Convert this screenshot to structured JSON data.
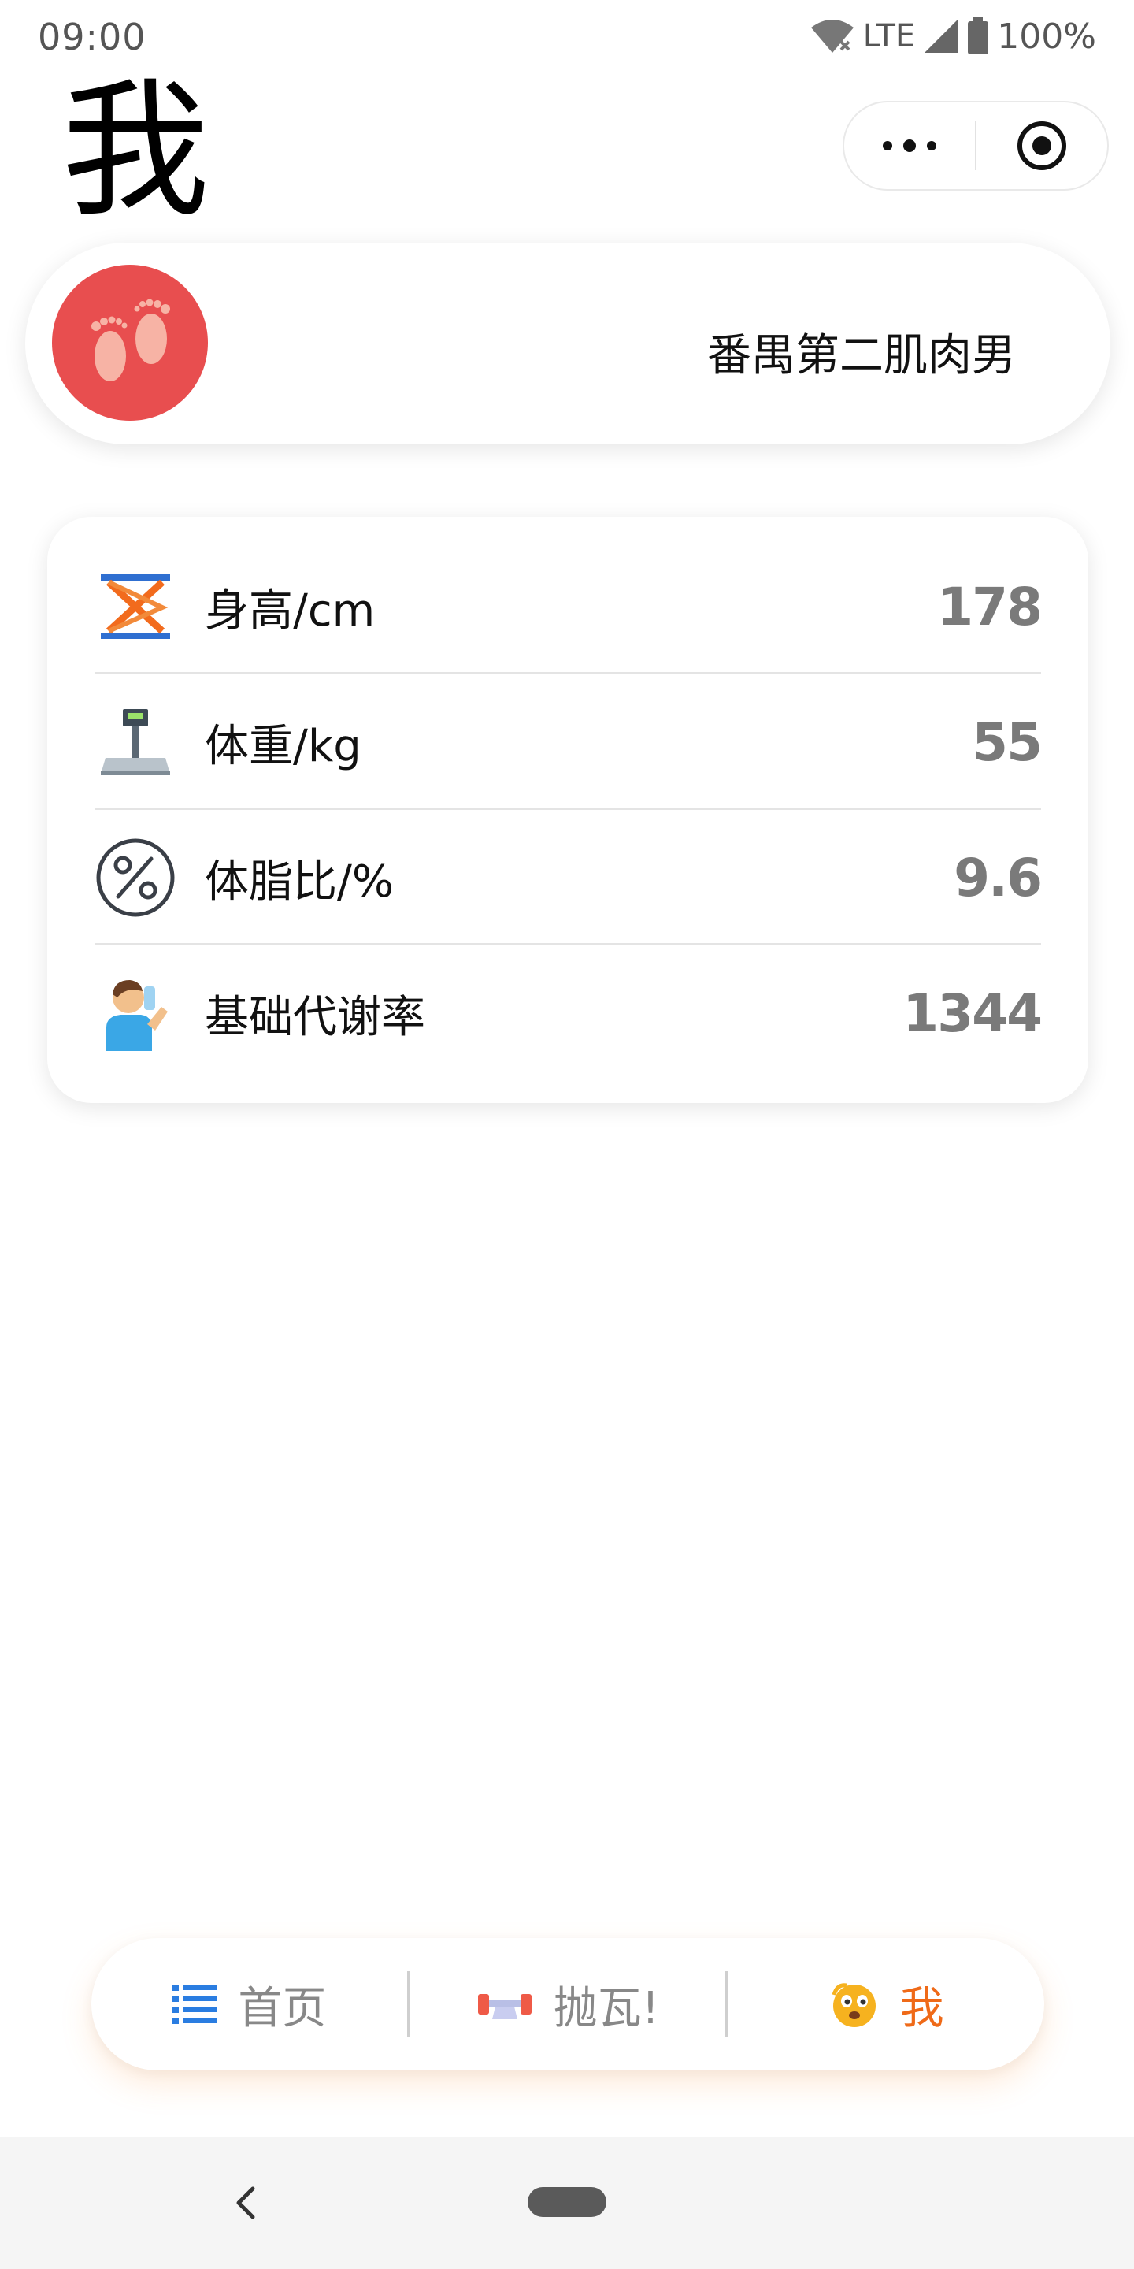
{
  "status_bar": {
    "time": "09:00",
    "network": "LTE",
    "battery": "100%"
  },
  "header": {
    "title": "我"
  },
  "profile": {
    "nickname": "番禺第二肌肉男",
    "avatar_icon": "footprints-icon",
    "avatar_color": "#e84e4f"
  },
  "stats": [
    {
      "icon": "scissor-lift-icon",
      "label": "身高/cm",
      "value": "178"
    },
    {
      "icon": "scale-icon",
      "label": "体重/kg",
      "value": "55"
    },
    {
      "icon": "percent-icon",
      "label": "体脂比/%",
      "value": "9.6"
    },
    {
      "icon": "drinking-man-icon",
      "label": "基础代谢率",
      "value": "1344"
    }
  ],
  "tabs": [
    {
      "icon": "list-icon",
      "label": "首页",
      "active": false
    },
    {
      "icon": "dumbbell-icon",
      "label": "抛瓦!",
      "active": false
    },
    {
      "icon": "emoji-face-icon",
      "label": "我",
      "active": true
    }
  ],
  "colors": {
    "accent": "#ef6a18",
    "value_gray": "#7a7a7a",
    "tab_inactive": "#888888"
  }
}
